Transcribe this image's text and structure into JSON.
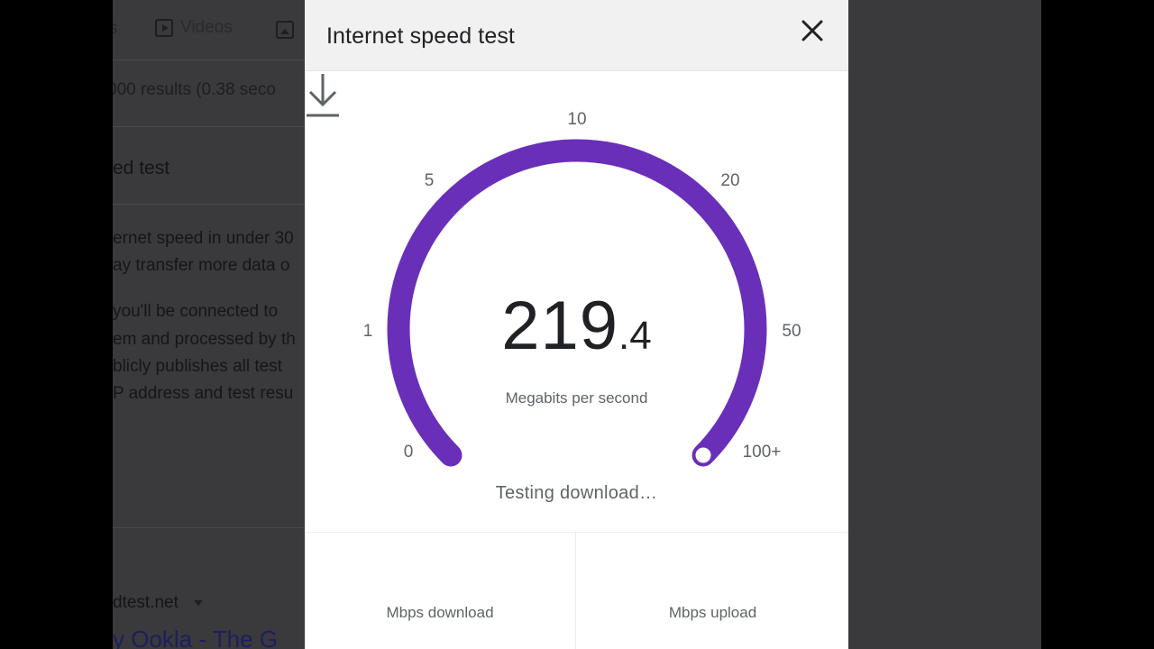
{
  "background_page": {
    "tab_fragment": "s",
    "videos_tab_label": "Videos",
    "results_text": "000 results (0.38 seco",
    "heading": "ed test",
    "para1": [
      "ernet speed in under 30",
      "ay transfer more data o"
    ],
    "para2": [
      "you'll be connected to",
      "em and processed by th",
      "blicly publishes all test",
      "P address and test resu"
    ],
    "site_url": "dtest.net",
    "link_title": "y Ookla - The G"
  },
  "dialog": {
    "title": "Internet speed test",
    "close_icon": "close-icon"
  },
  "gauge": {
    "tick_labels": [
      "0",
      "1",
      "5",
      "10",
      "20",
      "50",
      "100+"
    ],
    "arc_color": "#6a2fb8",
    "progress_fraction": 1.0,
    "current_value_int": "219",
    "current_value_dec": ".4",
    "unit": "Megabits per second",
    "status_icon": "download-arrow-icon",
    "status": "Testing download…"
  },
  "results": {
    "download_label": "Mbps download",
    "upload_label": "Mbps upload"
  },
  "colors": {
    "accent": "#6a2fb8",
    "overlay": "#3a393c",
    "text_secondary": "#5f6368"
  }
}
